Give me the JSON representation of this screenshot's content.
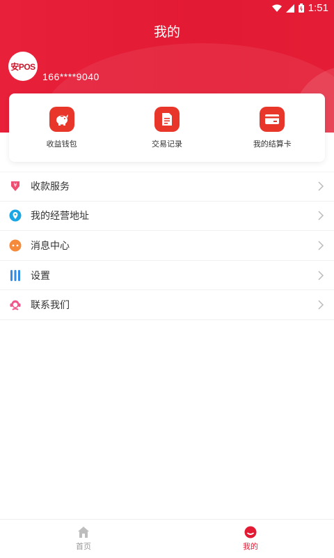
{
  "status_bar": {
    "time": "1:51"
  },
  "header": {
    "title": "我的"
  },
  "profile": {
    "avatar_text": "安POS",
    "phone": "166****9040"
  },
  "quick_actions": [
    {
      "label": "收益钱包",
      "icon": "piggy-bank-icon"
    },
    {
      "label": "交易记录",
      "icon": "document-icon"
    },
    {
      "label": "我的结算卡",
      "icon": "bank-card-icon"
    }
  ],
  "menu": [
    {
      "label": "收款服务",
      "icon": "yen-arrow-icon",
      "color": "#ef4f73"
    },
    {
      "label": "我的经营地址",
      "icon": "location-pin-icon",
      "color": "#1aa6e4"
    },
    {
      "label": "消息中心",
      "icon": "chat-bubble-icon",
      "color": "#f58a3a"
    },
    {
      "label": "设置",
      "icon": "settings-bars-icon",
      "color": "#2f8de8"
    },
    {
      "label": "联系我们",
      "icon": "headset-service-icon",
      "color": "#f0568a"
    }
  ],
  "tabbar": {
    "home_label": "首页",
    "mine_label": "我的"
  },
  "colors": {
    "brand": "#e31a33",
    "icon_bg": "#e8362a"
  }
}
